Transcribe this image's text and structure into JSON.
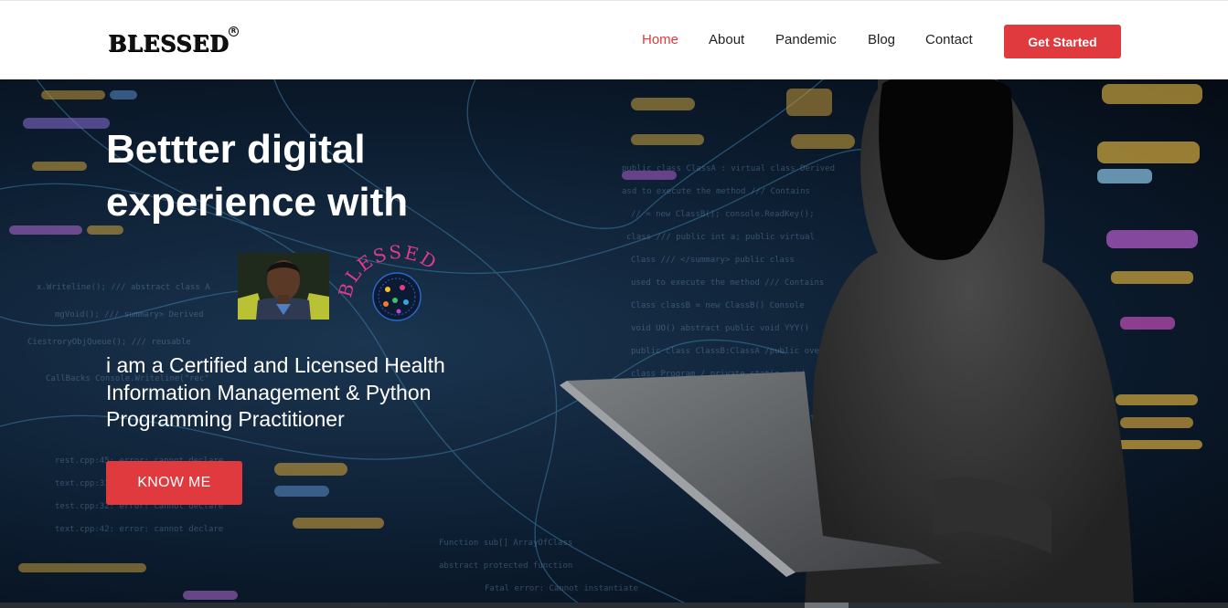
{
  "header": {
    "logo": "BLESSED",
    "logo_mark": "R",
    "nav": [
      {
        "label": "Home",
        "active": true
      },
      {
        "label": "About",
        "active": false
      },
      {
        "label": "Pandemic",
        "active": false
      },
      {
        "label": "Blog",
        "active": false
      },
      {
        "label": "Contact",
        "active": false
      }
    ],
    "cta": "Get Started"
  },
  "hero": {
    "title_line1": "Bettter digital",
    "title_line2": "experience with",
    "badge_text": "BLESSED",
    "subtitle": "i am a Certified and Licensed Health Information Management & Python Programming Practitioner",
    "button": "KNOW ME"
  },
  "colors": {
    "accent": "#e03a3e",
    "header_bg": "#ffffff",
    "hero_bg": "#0c1d30",
    "text_light": "#ffffff"
  },
  "icons": [
    "avatar-photo",
    "globe-people-icon",
    "hooded-figure-image",
    "laptop-image"
  ]
}
